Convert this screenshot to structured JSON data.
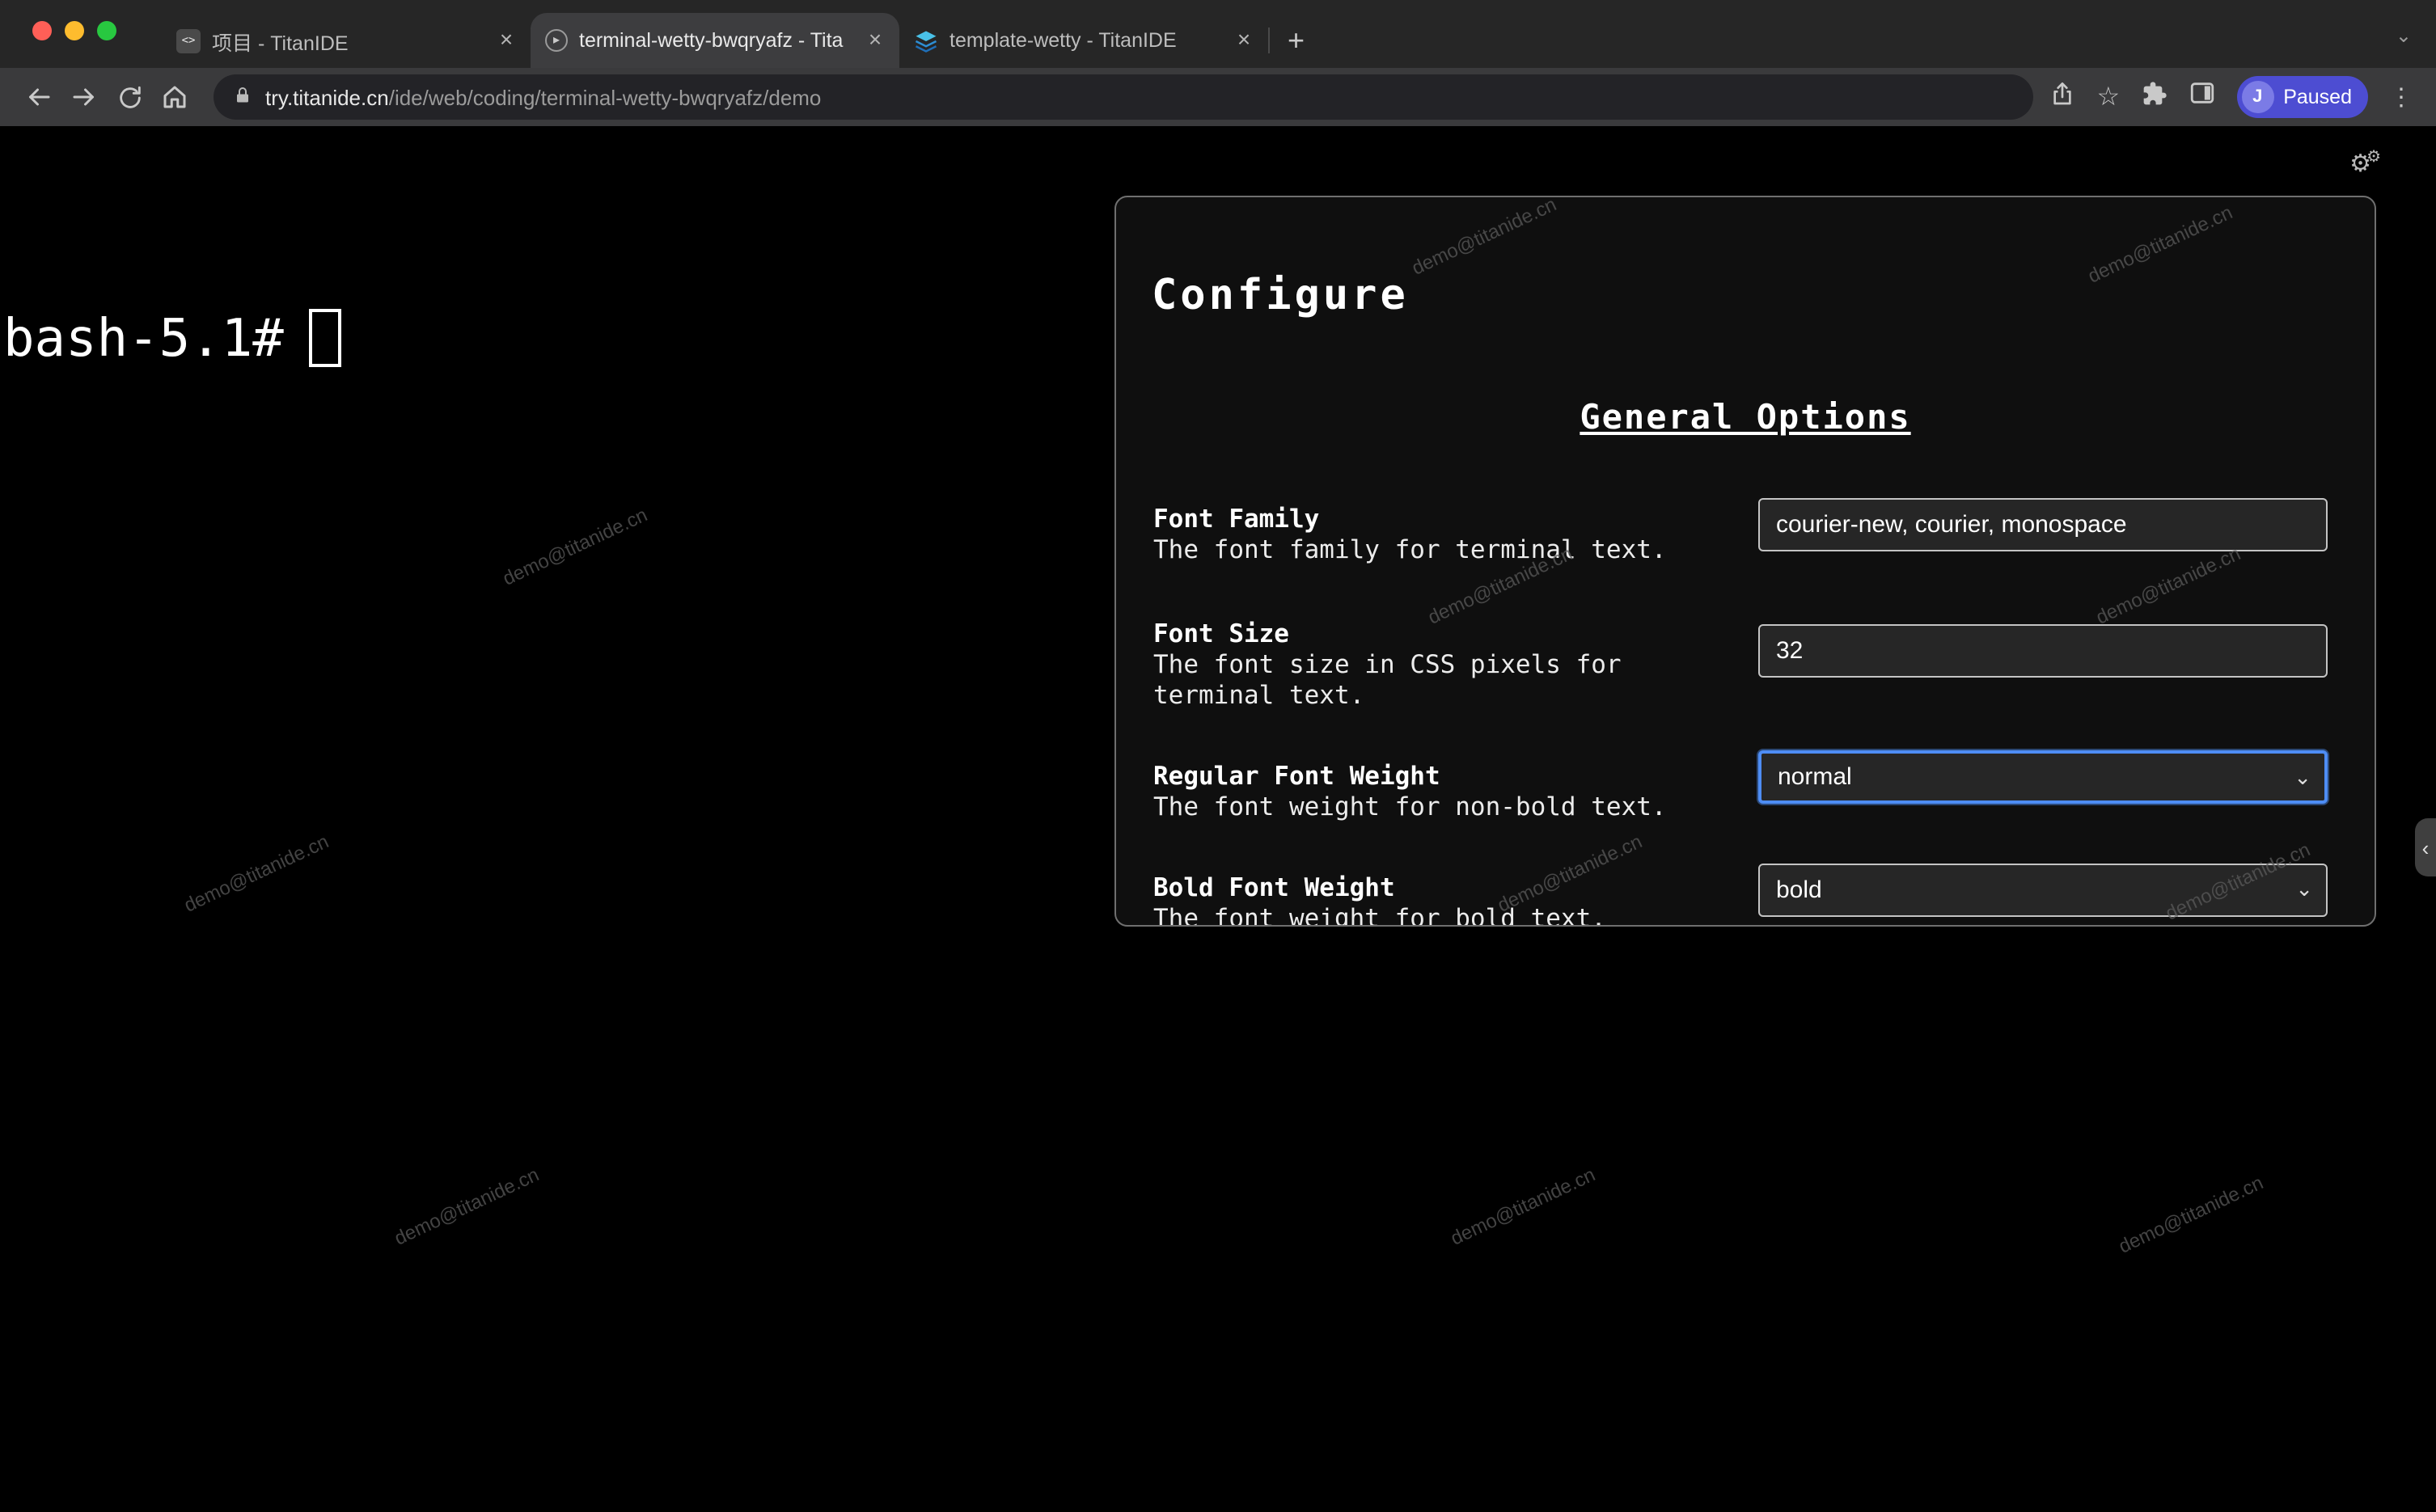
{
  "glyphs": {
    "close": "×",
    "plus": "+",
    "chevron_down": "⌄",
    "collapse": "‹",
    "gear": "⚙",
    "dots": "⋮",
    "star": "☆",
    "code_favicon": "<>",
    "play_favicon": "▸"
  },
  "browser": {
    "tabs": [
      {
        "title": "项目 - TitanIDE"
      },
      {
        "title": "terminal-wetty-bwqryafz - Tita"
      },
      {
        "title": "template-wetty - TitanIDE"
      }
    ],
    "url": {
      "domain": "try.titanide.cn",
      "path": "/ide/web/coding/terminal-wetty-bwqryafz/demo"
    },
    "profile": {
      "initial": "J",
      "label": "Paused"
    }
  },
  "terminal": {
    "prompt": "bash-5.1#",
    "watermark": "demo@titanide.cn"
  },
  "config": {
    "title": "Configure",
    "section": "General Options",
    "fields": [
      {
        "label": "Font Family",
        "desc": "The font family for terminal text.",
        "type": "input",
        "value": "courier-new, courier, monospace"
      },
      {
        "label": "Font Size",
        "desc": "The font size in CSS pixels for terminal text.",
        "type": "input",
        "value": "32"
      },
      {
        "label": "Regular Font Weight",
        "desc": "The font weight for non-bold text.",
        "type": "select",
        "value": "normal"
      },
      {
        "label": "Bold Font Weight",
        "desc": "The font weight for bold text.",
        "type": "select",
        "value": "bold"
      }
    ]
  }
}
